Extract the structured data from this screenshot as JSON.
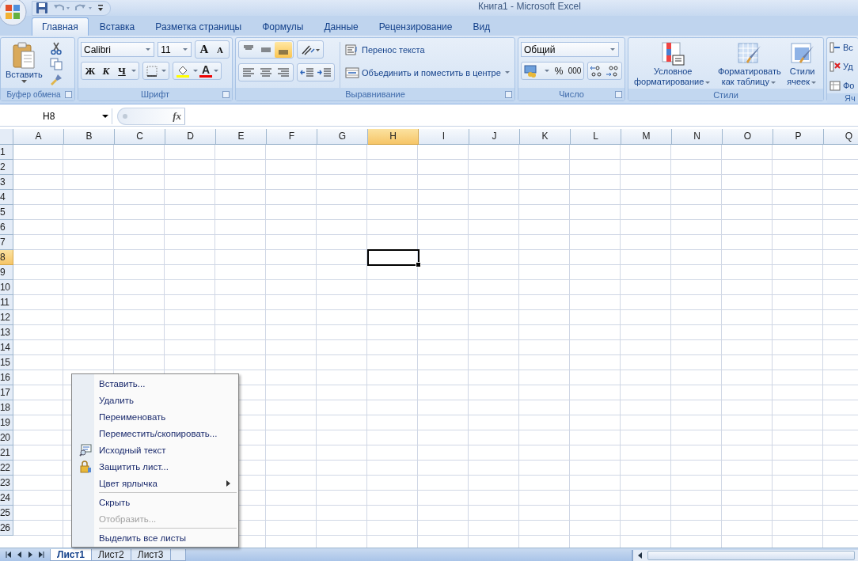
{
  "window": {
    "title": "Книга1 - Microsoft Excel"
  },
  "tabs": [
    {
      "label": "Главная",
      "selected": true
    },
    {
      "label": "Вставка",
      "selected": false
    },
    {
      "label": "Разметка страницы",
      "selected": false
    },
    {
      "label": "Формулы",
      "selected": false
    },
    {
      "label": "Данные",
      "selected": false
    },
    {
      "label": "Рецензирование",
      "selected": false
    },
    {
      "label": "Вид",
      "selected": false
    }
  ],
  "clipboard": {
    "label": "Буфер обмена",
    "paste": "Вставить"
  },
  "font": {
    "label": "Шрифт",
    "font_name": "Calibri",
    "font_size": "11",
    "grow": "A",
    "shrink": "A",
    "bold": "Ж",
    "italic": "К",
    "underline": "Ч",
    "color_letter": "A"
  },
  "alignment": {
    "label": "Выравнивание",
    "wrap": "Перенос текста",
    "merge": "Объединить и поместить в центре",
    "vertical": [
      {
        "selected": false
      },
      {
        "selected": false
      },
      {
        "selected": true
      }
    ]
  },
  "number": {
    "label": "Число",
    "format": "Общий",
    "percent": "%",
    "thousands": "000"
  },
  "styles": {
    "label": "Стили",
    "buttons": [
      {
        "lines": [
          "Условное",
          "форматирование"
        ],
        "kind": "conditional"
      },
      {
        "lines": [
          "Форматировать",
          "как таблицу"
        ],
        "kind": "table"
      },
      {
        "lines": [
          "Стили",
          "ячеек"
        ],
        "kind": "cell"
      }
    ]
  },
  "cells": {
    "label": "Яч",
    "items": [
      {
        "label": "Вс",
        "kind": "insert"
      },
      {
        "label": "Уд",
        "kind": "delete"
      },
      {
        "label": "Фо",
        "kind": "format"
      }
    ]
  },
  "formula_bar": {
    "name_box": "H8",
    "fx": "fx"
  },
  "columns": [
    {
      "label": "A",
      "selected": false
    },
    {
      "label": "B",
      "selected": false
    },
    {
      "label": "C",
      "selected": false
    },
    {
      "label": "D",
      "selected": false
    },
    {
      "label": "E",
      "selected": false
    },
    {
      "label": "F",
      "selected": false
    },
    {
      "label": "G",
      "selected": false
    },
    {
      "label": "H",
      "selected": true
    },
    {
      "label": "I",
      "selected": false
    },
    {
      "label": "J",
      "selected": false
    },
    {
      "label": "K",
      "selected": false
    },
    {
      "label": "L",
      "selected": false
    },
    {
      "label": "M",
      "selected": false
    },
    {
      "label": "N",
      "selected": false
    },
    {
      "label": "O",
      "selected": false
    },
    {
      "label": "P",
      "selected": false
    },
    {
      "label": "Q",
      "selected": false
    }
  ],
  "rows": [
    {
      "label": "1",
      "selected": false
    },
    {
      "label": "2",
      "selected": false
    },
    {
      "label": "3",
      "selected": false
    },
    {
      "label": "4",
      "selected": false
    },
    {
      "label": "5",
      "selected": false
    },
    {
      "label": "6",
      "selected": false
    },
    {
      "label": "7",
      "selected": false
    },
    {
      "label": "8",
      "selected": true
    },
    {
      "label": "9",
      "selected": false
    },
    {
      "label": "10",
      "selected": false
    },
    {
      "label": "11",
      "selected": false
    },
    {
      "label": "12",
      "selected": false
    },
    {
      "label": "13",
      "selected": false
    },
    {
      "label": "14",
      "selected": false
    },
    {
      "label": "15",
      "selected": false
    },
    {
      "label": "16",
      "selected": false
    },
    {
      "label": "17",
      "selected": false
    },
    {
      "label": "18",
      "selected": false
    },
    {
      "label": "19",
      "selected": false
    },
    {
      "label": "20",
      "selected": false
    },
    {
      "label": "21",
      "selected": false
    },
    {
      "label": "22",
      "selected": false
    },
    {
      "label": "23",
      "selected": false
    },
    {
      "label": "24",
      "selected": false
    },
    {
      "label": "25",
      "selected": false
    },
    {
      "label": "26",
      "selected": false
    }
  ],
  "sheet_tabs": [
    {
      "label": "Лист1",
      "selected": true
    },
    {
      "label": "Лист2",
      "selected": false
    },
    {
      "label": "Лист3",
      "selected": false
    }
  ],
  "context_menu": [
    {
      "label": "Вставить...",
      "kind": "plain",
      "disabled": false,
      "separator_before": false
    },
    {
      "label": "Удалить",
      "kind": "plain",
      "disabled": false,
      "separator_before": false
    },
    {
      "label": "Переименовать",
      "kind": "plain",
      "disabled": false,
      "separator_before": false
    },
    {
      "label": "Переместить/скопировать...",
      "kind": "plain",
      "disabled": false,
      "separator_before": false
    },
    {
      "label": "Исходный текст",
      "kind": "source",
      "disabled": false,
      "separator_before": false
    },
    {
      "label": "Защитить лист...",
      "kind": "protect",
      "disabled": false,
      "separator_before": false
    },
    {
      "label": "Цвет ярлычка",
      "kind": "submenu",
      "disabled": false,
      "separator_before": false
    },
    {
      "label": "Скрыть",
      "kind": "plain",
      "disabled": false,
      "separator_before": true
    },
    {
      "label": "Отобразить...",
      "kind": "plain",
      "disabled": true,
      "separator_before": false
    },
    {
      "label": "Выделить все листы",
      "kind": "plain",
      "disabled": false,
      "separator_before": true
    }
  ]
}
